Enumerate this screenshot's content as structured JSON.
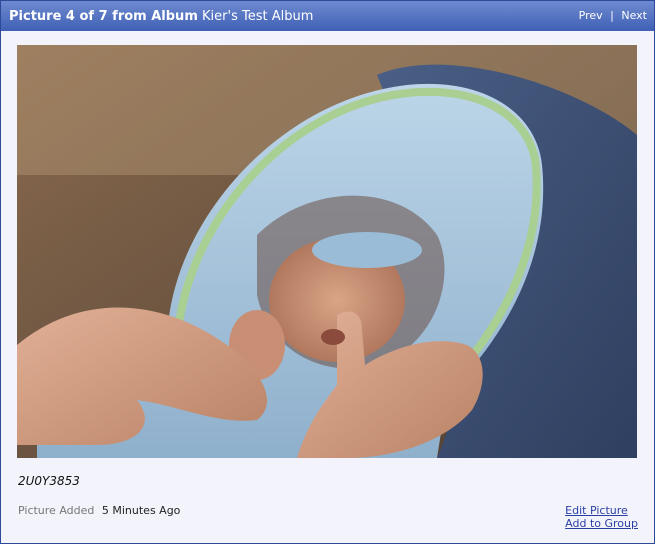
{
  "header": {
    "position_label": "Picture 4 of 7 from Album",
    "album_name": "Kier's Test Album",
    "prev_label": "Prev",
    "separator": "|",
    "next_label": "Next"
  },
  "photo": {
    "subject": "newborn baby wrapped in blue hooded towel sucking on an adult finger"
  },
  "caption": "2U0Y3853",
  "meta": {
    "added_label": "Picture Added",
    "added_ago": "5 Minutes Ago"
  },
  "actions": {
    "edit_label": "Edit Picture",
    "add_group_label": "Add to Group"
  },
  "colors": {
    "header_bar": "#3f60b5",
    "link": "#2b3fa3",
    "panel_bg": "#f3f4fb"
  }
}
